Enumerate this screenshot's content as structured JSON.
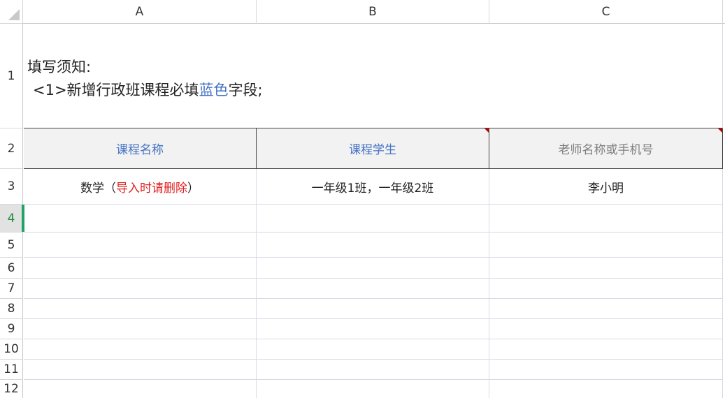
{
  "columns": [
    "A",
    "B",
    "C"
  ],
  "rows": [
    "1",
    "2",
    "3",
    "4",
    "5",
    "6",
    "7",
    "8",
    "9",
    "10",
    "11",
    "12"
  ],
  "active_row": "4",
  "notice": {
    "line1": "填写须知:",
    "line2_prefix": "<1>新增行政班课程必填",
    "line2_highlight": "蓝色",
    "line2_suffix": "字段;"
  },
  "headers": {
    "a": "课程名称",
    "b": "课程学生",
    "c": "老师名称或手机号"
  },
  "example": {
    "a_main": "数学（",
    "a_red": "导入时请删除",
    "a_close": "）",
    "b": "一年级1班，一年级2班",
    "c": "李小明"
  },
  "colors": {
    "required_header": "#4472c4",
    "optional_header": "#7f7f7f",
    "warning": "#e02020",
    "selection": "#21a366",
    "comment_marker": "#c00000"
  }
}
